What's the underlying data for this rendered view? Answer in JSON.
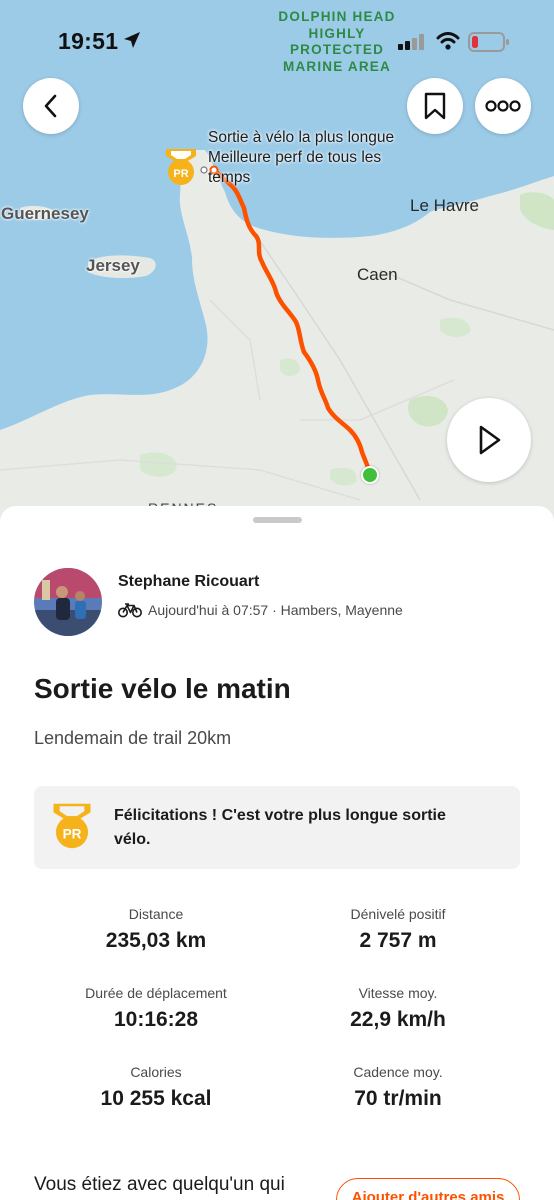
{
  "status_bar": {
    "time": "19:51",
    "battery_color": "#e0323a"
  },
  "map": {
    "marine_area_label": "DOLPHIN HEAD HIGHLY PROTECTED MARINE AREA",
    "places": {
      "guernesey": "Guernesey",
      "jersey": "Jersey",
      "le_havre": "Le Havre",
      "caen": "Caen",
      "rennes_partial": "RENNES"
    },
    "pr_badge": "PR",
    "pr_annotation_line1": "Sortie à vélo la plus longue",
    "pr_annotation_line2": "Meilleure perf de tous les temps",
    "route_color": "#fc5200",
    "end_marker_color": "#3fbf3a",
    "sea_color": "#9ccbe8",
    "land_color": "#e8eae6"
  },
  "activity": {
    "athlete_name": "Stephane Ricouart",
    "date_location": "Aujourd'hui à 07:57 · Hambers, Mayenne",
    "title": "Sortie vélo le matin",
    "description": "Lendemain de trail 20km",
    "achievement_badge": "PR",
    "achievement_text": "Félicitations ! C'est votre plus longue sortie vélo."
  },
  "stats": {
    "distance_label": "Distance",
    "distance_value": "235,03 km",
    "elevation_label": "Dénivelé positif",
    "elevation_value": "2 757 m",
    "moving_time_label": "Durée de déplacement",
    "moving_time_value": "10:16:28",
    "avg_speed_label": "Vitesse moy.",
    "avg_speed_value": "22,9 km/h",
    "calories_label": "Calories",
    "calories_value": "10 255 kcal",
    "cadence_label": "Cadence moy.",
    "cadence_value": "70 tr/min"
  },
  "footer": {
    "with_someone_text": "Vous étiez avec quelqu'un qui",
    "add_friends_label": "Ajouter d'autres amis"
  },
  "colors": {
    "accent": "#fc5200",
    "pr_gold": "#f5b21b"
  }
}
